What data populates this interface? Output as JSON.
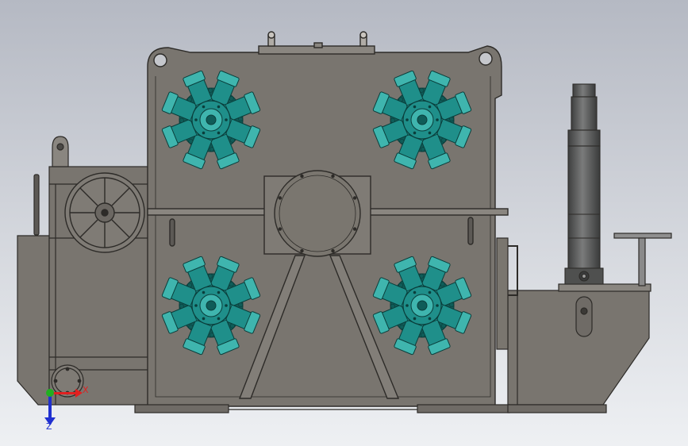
{
  "viewport": {
    "background_top": "#b5b9c3",
    "background_bottom": "#eef0f3"
  },
  "colors": {
    "housing_fill": "#79756f",
    "housing_dark": "#6b6762",
    "housing_light": "#8a8680",
    "outline": "#2d2b28",
    "motor_fill": "#1f8f8a",
    "motor_light": "#3fb5ae",
    "motor_dark": "#0f5c58",
    "cylinder_fill": "#5f605f",
    "platform_fill": "#8f8f8f"
  },
  "hydraulic_motors": [
    {
      "name": "top-left"
    },
    {
      "name": "top-right"
    },
    {
      "name": "bottom-left"
    },
    {
      "name": "bottom-right"
    }
  ],
  "triad": {
    "x_label": "X",
    "z_label": "Z",
    "x_color": "#e02020",
    "z_color": "#2030d0",
    "origin_color": "#20b020"
  }
}
